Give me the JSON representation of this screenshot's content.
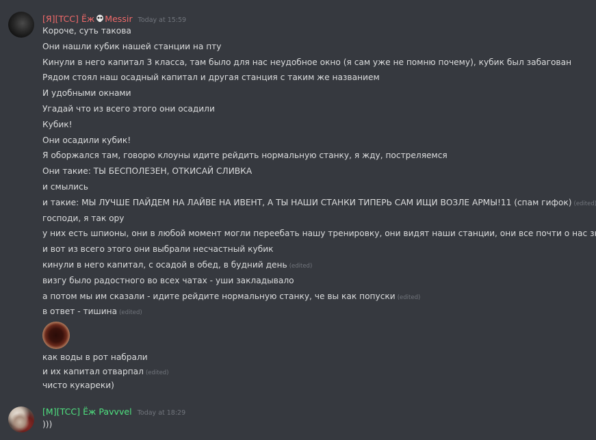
{
  "messages": [
    {
      "author": "[Я][TCC] Ёж",
      "author_suffix": "Messir",
      "timestamp": "Today at 15:59",
      "lines": [
        {
          "text": "Короче, суть такова",
          "edited": ""
        },
        {
          "text": "Они нашли кубик нашей станции на пту",
          "edited": ""
        },
        {
          "text": "Кинули в него капитал 3 класса, там было для нас неудобное окно (я сам уже не помню почему), кубик был забагован",
          "edited": ""
        },
        {
          "text": "Рядом стоял наш осадный капитал и другая станция с таким же названием",
          "edited": ""
        },
        {
          "text": "И удобными окнами",
          "edited": ""
        },
        {
          "text": "Угадай что из всего этого они осадили",
          "edited": ""
        },
        {
          "text": "Кубик!",
          "edited": ""
        },
        {
          "text": "Они осадили кубик!",
          "edited": ""
        },
        {
          "text": "Я оборжался там, говорю клоуны идите рейдить нормальную станку, я жду, постреляемся",
          "edited": ""
        },
        {
          "text": "Они такие: ТЫ БЕСПОЛЕЗЕН, ОТКИСАЙ СЛИВКА",
          "edited": ""
        },
        {
          "text": "и смылись",
          "edited": ""
        },
        {
          "text": "и такие: МЫ ЛУЧШЕ ПАЙДЕМ НА ЛАЙВЕ НА ИВЕНТ, А ТЫ НАШИ СТАНКИ ТИПЕРЬ САМ ИЩИ ВОЗЛЕ АРМЫ!11 (спам гифок)",
          "edited": "(edited)"
        },
        {
          "text": "господи, я так ору",
          "edited": ""
        },
        {
          "text": "у них есть шпионы, они в любой момент могли переебать нашу тренировку, они видят наши станции, они все почти о нас знают",
          "edited": ""
        },
        {
          "text": "и вот из всего этого они выбрали несчастный кубик",
          "edited": ""
        },
        {
          "text": "кинули в него капитал, с осадой в обед, в будний день",
          "edited": "(edited)"
        },
        {
          "text": "визгу было радостного во всех чатах - уши закладывало",
          "edited": ""
        },
        {
          "text": "а потом мы им сказали - идите рейдите нормальную станку, че вы как попуски",
          "edited": "(edited)"
        },
        {
          "text": "в ответ - тишина",
          "edited": "(edited)"
        }
      ],
      "after_image_lines": [
        {
          "text": "как воды в рот набрали",
          "edited": ""
        },
        {
          "text": "и их капитал отварпал",
          "edited": "(edited)"
        },
        {
          "text": "чисто кукареки)",
          "edited": ""
        }
      ]
    },
    {
      "author": "[M][TCC] Ёж Pavvvel",
      "timestamp": "Today at 18:29",
      "lines": [
        {
          "text": ")))",
          "edited": ""
        }
      ]
    }
  ],
  "colors": {
    "background": "#36393f",
    "text": "#dcddde",
    "muted": "#72767d",
    "author1": "#f26a6a",
    "author2": "#4fe380"
  }
}
